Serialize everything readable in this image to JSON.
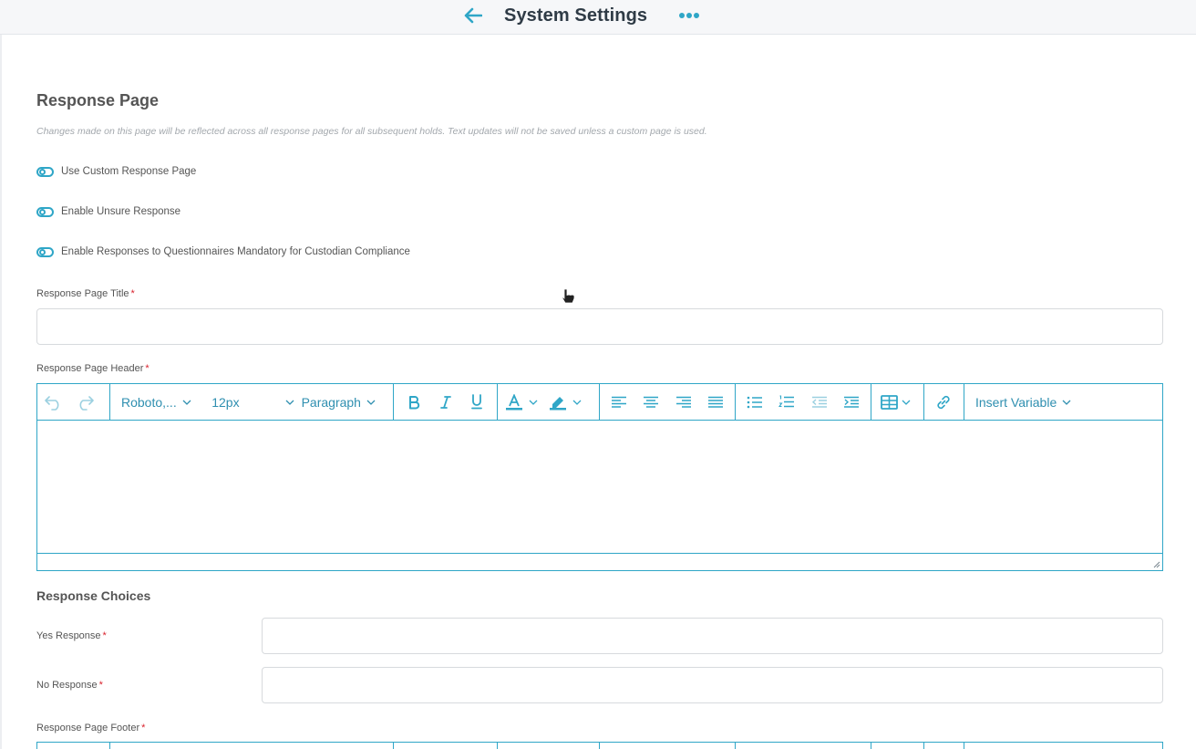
{
  "header": {
    "title": "System Settings"
  },
  "section": {
    "title": "Response Page",
    "info": "Changes made on this page will be reflected across all response pages for all subsequent holds. Text updates will not be saved unless a custom page is used."
  },
  "toggles": [
    {
      "label": "Use Custom Response Page"
    },
    {
      "label": "Enable Unsure Response"
    },
    {
      "label": "Enable Responses to Questionnaires Mandatory for Custodian Compliance"
    }
  ],
  "fields": {
    "title_label": "Response Page Title",
    "title_value": "",
    "header_label": "Response Page Header",
    "footer_label": "Response Page Footer",
    "required_mark": "*"
  },
  "editor": {
    "font_family": "Roboto,...",
    "font_size": "12px",
    "block_format": "Paragraph",
    "insert_variable": "Insert Variable"
  },
  "choices": {
    "title": "Response Choices",
    "yes_label": "Yes Response",
    "yes_value": "",
    "no_label": "No Response",
    "no_value": ""
  },
  "colors": {
    "accent": "#2fa6c7",
    "required": "#d9232e",
    "title": "#2f3b46"
  },
  "icons": {
    "back": "arrow-left-icon",
    "more": "more-horizontal-icon"
  }
}
